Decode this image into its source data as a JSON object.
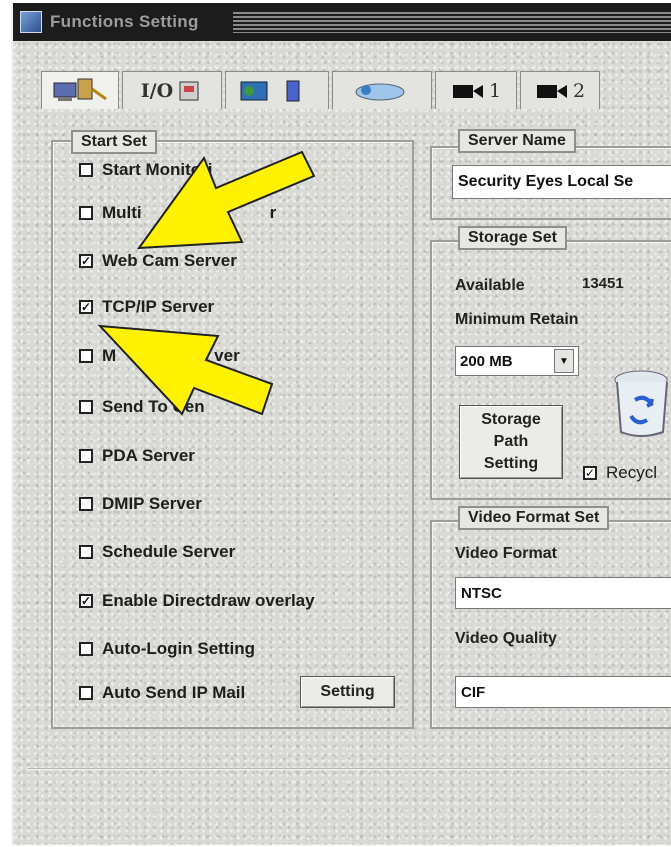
{
  "window": {
    "title": "Functions Setting"
  },
  "tabs": [
    {
      "label": "",
      "icon": "network-computers-icon"
    },
    {
      "label": "I/O",
      "icon": "io-icon"
    },
    {
      "label": "",
      "icon": "device-phone-icon"
    },
    {
      "label": "",
      "icon": "cloud-network-icon"
    },
    {
      "label": "1",
      "icon": "camera-icon"
    },
    {
      "label": "2",
      "icon": "camera-icon"
    }
  ],
  "start_set": {
    "legend": "Start Set",
    "items": [
      {
        "label": "Start Monitori",
        "checked": false
      },
      {
        "label": "Multi",
        "suffix": "r",
        "checked": false
      },
      {
        "label": "Web Cam Server",
        "checked": true
      },
      {
        "label": "TCP/IP Server",
        "checked": true
      },
      {
        "label": "M",
        "suffix": "ver",
        "checked": false
      },
      {
        "label": "Send To Cen",
        "checked": false
      },
      {
        "label": "PDA Server",
        "checked": false
      },
      {
        "label": "DMIP Server",
        "checked": false
      },
      {
        "label": "Schedule Server",
        "checked": false
      },
      {
        "label": "Enable Directdraw overlay",
        "checked": true
      },
      {
        "label": "Auto-Login Setting",
        "checked": false
      },
      {
        "label": "Auto Send IP Mail",
        "checked": false
      }
    ],
    "setting_button": "Setting"
  },
  "server_name": {
    "legend": "Server Name",
    "value": "Security Eyes Local Se"
  },
  "storage_set": {
    "legend": "Storage Set",
    "available_label": "Available",
    "available_value": "13451",
    "min_retain_label": "Minimum Retain",
    "min_retain_value": "200 MB",
    "path_button_line1": "Storage",
    "path_button_line2": "Path",
    "path_button_line3": "Setting",
    "recycle_label": "Recycl",
    "recycle_checked": true
  },
  "video_format_set": {
    "legend": "Video Format Set",
    "format_label": "Video Format",
    "format_value": "NTSC",
    "quality_label": "Video Quality",
    "quality_value": "CIF"
  },
  "colors": {
    "arrow": "#fff200",
    "titlebar": "#1c1c1c"
  }
}
